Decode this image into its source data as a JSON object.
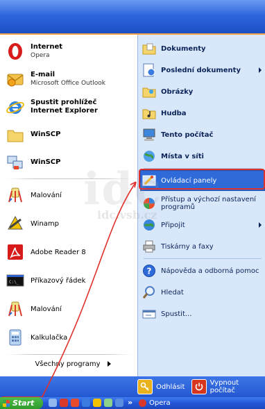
{
  "pinned": [
    {
      "label": "Internet",
      "sub": "Opera",
      "icon": "opera-icon"
    },
    {
      "label": "E-mail",
      "sub": "Microsoft Office Outlook",
      "icon": "outlook-icon"
    },
    {
      "label": "Spustit prohlížeč",
      "sub": "Internet Explorer",
      "icon": "internet-explorer-icon"
    },
    {
      "label": "WinSCP",
      "sub": "",
      "icon": "folder-icon"
    },
    {
      "label": "WinSCP",
      "sub": "",
      "icon": "winscp-icon"
    }
  ],
  "recent": [
    {
      "label": "Malování",
      "icon": "paint-icon"
    },
    {
      "label": "Winamp",
      "icon": "winamp-icon"
    },
    {
      "label": "Adobe Reader 8",
      "icon": "adobe-reader-icon"
    },
    {
      "label": "Příkazový řádek",
      "icon": "command-prompt-icon"
    },
    {
      "label": "Malování",
      "icon": "paint-icon"
    },
    {
      "label": "Kalkulačka",
      "icon": "calculator-icon"
    }
  ],
  "all_programs": "Všechny programy",
  "right": [
    {
      "label": "Dokumenty",
      "bold": true,
      "icon": "documents-folder-icon"
    },
    {
      "label": "Poslední dokumenty",
      "bold": true,
      "icon": "recent-documents-icon",
      "submenu": true
    },
    {
      "label": "Obrázky",
      "bold": true,
      "icon": "pictures-folder-icon"
    },
    {
      "label": "Hudba",
      "bold": true,
      "icon": "music-folder-icon"
    },
    {
      "label": "Tento počítač",
      "bold": true,
      "icon": "my-computer-icon"
    },
    {
      "label": "Místa v síti",
      "bold": true,
      "icon": "network-places-icon"
    },
    {
      "label": "Ovládací panely",
      "bold": false,
      "icon": "control-panel-icon",
      "selected": true
    },
    {
      "label": "Přístup a výchozí nastavení programů",
      "bold": false,
      "icon": "program-access-icon"
    },
    {
      "label": "Připojit",
      "bold": false,
      "icon": "connect-icon",
      "submenu": true
    },
    {
      "label": "Tiskárny a faxy",
      "bold": false,
      "icon": "printer-icon"
    },
    {
      "label": "Nápověda a odborná pomoc",
      "bold": false,
      "icon": "help-icon"
    },
    {
      "label": "Hledat",
      "bold": false,
      "icon": "search-icon"
    },
    {
      "label": "Spustit...",
      "bold": false,
      "icon": "run-icon"
    }
  ],
  "footer": {
    "logoff": "Odhlásit",
    "shutdown": "Vypnout počítač"
  },
  "taskbar": {
    "start": "Start",
    "overflow": "»",
    "app": "Opera"
  },
  "colors": {
    "highlight": "#2f6bd8",
    "annotation": "#e0312a",
    "header": "#2f66dd"
  }
}
